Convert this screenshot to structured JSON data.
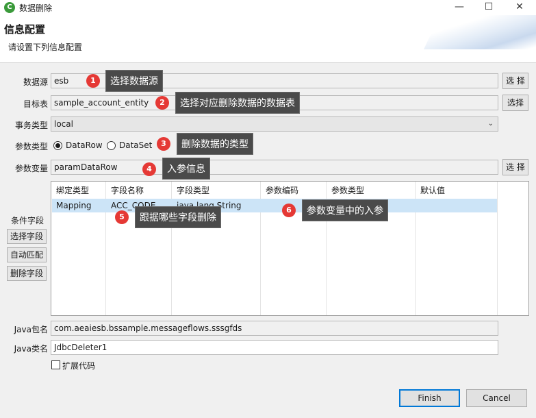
{
  "window": {
    "icon_glyph": "C",
    "title": "数据删除",
    "minimize_glyph": "—",
    "maximize_glyph": "☐",
    "close_glyph": "✕"
  },
  "header": {
    "title": "信息配置",
    "subtitle": "请设置下列信息配置"
  },
  "form": {
    "datasource": {
      "label": "数据源",
      "value": "esb",
      "button": "选 择"
    },
    "target_table": {
      "label": "目标表",
      "value": "sample_account_entity",
      "button": "选择"
    },
    "transaction_type": {
      "label": "事务类型",
      "value": "local",
      "arrow": "⌄"
    },
    "param_type": {
      "label": "参数类型",
      "options": [
        "DataRow",
        "DataSet"
      ],
      "selected": "DataRow"
    },
    "param_variable": {
      "label": "参数变量",
      "value": "paramDataRow",
      "button": "选 择"
    },
    "java_package": {
      "label": "Java包名",
      "value": "com.aeaiesb.bssample.messageflows.sssgfds"
    },
    "java_class": {
      "label": "Java类名",
      "value": "JdbcDeleter1"
    },
    "extend_code": {
      "label": "扩展代码",
      "checked": false
    }
  },
  "condition": {
    "label": "条件字段",
    "buttons": [
      "选择字段",
      "自动匹配",
      "删除字段"
    ],
    "columns": [
      "绑定类型",
      "字段名称",
      "字段类型",
      "参数编码",
      "参数类型",
      "默认值"
    ],
    "rows": [
      [
        "Mapping",
        "ACC_CODE",
        "java.lang.String",
        "",
        "",
        ""
      ]
    ]
  },
  "footer": {
    "finish": "Finish",
    "cancel": "Cancel"
  },
  "annotations": [
    {
      "num": "1",
      "text": "选择数据源"
    },
    {
      "num": "2",
      "text": "选择对应删除数据的数据表"
    },
    {
      "num": "3",
      "text": "删除数据的类型"
    },
    {
      "num": "4",
      "text": "入参信息"
    },
    {
      "num": "5",
      "text": "跟据哪些字段删除"
    },
    {
      "num": "6",
      "text": "参数变量中的入参"
    }
  ],
  "colors": {
    "badge": "#e53935",
    "callout": "#4a4a4a",
    "selection": "#cce4f7",
    "primary_border": "#0078d7"
  }
}
